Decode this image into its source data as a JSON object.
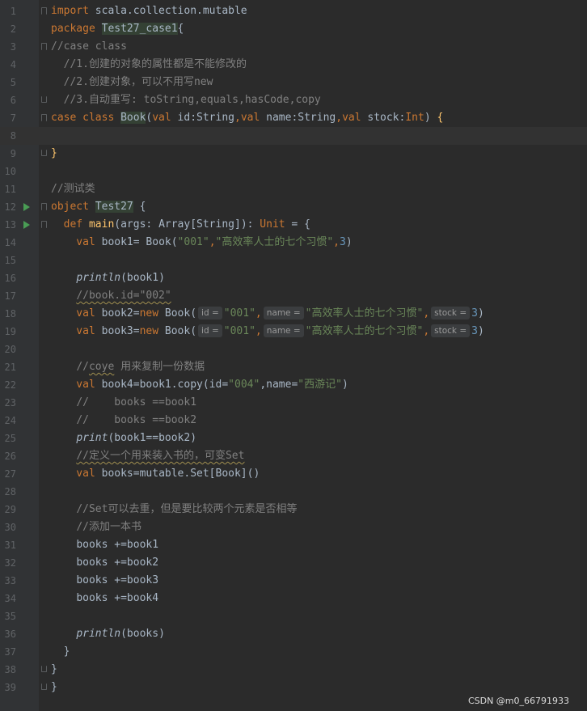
{
  "editor": {
    "lines": [
      {
        "n": "1"
      },
      {
        "n": "2"
      },
      {
        "n": "3"
      },
      {
        "n": "4"
      },
      {
        "n": "5"
      },
      {
        "n": "6"
      },
      {
        "n": "7"
      },
      {
        "n": "8"
      },
      {
        "n": "9"
      },
      {
        "n": "10"
      },
      {
        "n": "11"
      },
      {
        "n": "12"
      },
      {
        "n": "13"
      },
      {
        "n": "14"
      },
      {
        "n": "15"
      },
      {
        "n": "16"
      },
      {
        "n": "17"
      },
      {
        "n": "18"
      },
      {
        "n": "19"
      },
      {
        "n": "20"
      },
      {
        "n": "21"
      },
      {
        "n": "22"
      },
      {
        "n": "23"
      },
      {
        "n": "24"
      },
      {
        "n": "25"
      },
      {
        "n": "26"
      },
      {
        "n": "27"
      },
      {
        "n": "28"
      },
      {
        "n": "29"
      },
      {
        "n": "30"
      },
      {
        "n": "31"
      },
      {
        "n": "32"
      },
      {
        "n": "33"
      },
      {
        "n": "34"
      },
      {
        "n": "35"
      },
      {
        "n": "36"
      },
      {
        "n": "37"
      },
      {
        "n": "38"
      },
      {
        "n": "39"
      }
    ],
    "code": {
      "l1_kw": "import",
      "l1_rest": " scala.collection.mutable",
      "l2_kw": "package",
      "l2_name": "Test27_case1",
      "l2_brace": "{",
      "l3": "//case class",
      "l4": "  //1.创建的对象的属性都是不能修改的",
      "l5": "  //2.创建对象，可以不用写new",
      "l6": "  //3.自动重写: toString,equals,hasCode,copy",
      "l7_kw": "case class ",
      "l7_name": "Book",
      "l7_open": "(",
      "l7_v1": "val ",
      "l7_p1": "id:String",
      "l7_c1": ",",
      "l7_v2": "val ",
      "l7_p2": "name:String",
      "l7_c2": ",",
      "l7_v3": "val ",
      "l7_p3": "stock:",
      "l7_int": "Int",
      "l7_close": ") ",
      "l7_brace": "{",
      "l9": "}",
      "l11": "//测试类",
      "l12_kw": "object ",
      "l12_name": "Test27",
      "l12_rest": " {",
      "l13_kw": "  def ",
      "l13_fn": "main",
      "l13_args": "(args: Array[String]): ",
      "l13_unit": "Unit",
      "l13_rest": " = {",
      "l14_kw": "    val ",
      "l14_a": "book1= Book(",
      "l14_s1": "\"001\"",
      "l14_c": ",",
      "l14_s2": "\"高效率人士的七个习惯\"",
      "l14_c2": ",",
      "l14_n": "3",
      "l14_e": ")",
      "l16_fn": "println",
      "l16_rest": "(book1)",
      "l17": "//book.id=\"002\"",
      "l18_kw": "    val ",
      "l18_a": "book2=",
      "l18_new": "new ",
      "l18_b": "Book(",
      "l18_h1": "id =",
      "l18_s1": "\"001\"",
      "l18_c1": ",",
      "l18_h2": "name =",
      "l18_s2": "\"高效率人士的七个习惯\"",
      "l18_c2": ",",
      "l18_h3": "stock =",
      "l18_n": "3",
      "l18_e": ")",
      "l19_kw": "    val ",
      "l19_a": "book3=",
      "l19_new": "new ",
      "l19_b": "Book(",
      "l19_h1": "id =",
      "l19_s1": "\"001\"",
      "l19_c1": ",",
      "l19_h2": "name =",
      "l19_s2": "\"高效率人士的七个习惯\"",
      "l19_c2": ",",
      "l19_h3": "stock =",
      "l19_n": "3",
      "l19_e": ")",
      "l21a": "//",
      "l21b": "coye",
      "l21c": " 用来复制一份数据",
      "l22_kw": "    val ",
      "l22_a": "book4=book1.copy(id=",
      "l22_s1": "\"004\"",
      "l22_c": ",name=",
      "l22_s2": "\"西游记\"",
      "l22_e": ")",
      "l23": "//    books ==book1",
      "l24": "//    books ==book2",
      "l25_fn": "print",
      "l25_rest": "(book1==book2)",
      "l26": "//定义一个用来装入书的，可变Set",
      "l27_kw": "    val ",
      "l27_rest": "books=mutable.Set[Book]()",
      "l29": "//Set可以去重，但是要比较两个元素是否相等",
      "l30": "//添加一本书",
      "l31": "books +=book1",
      "l32": "books +=book2",
      "l33": "books +=book3",
      "l34": "books +=book4",
      "l36_fn": "println",
      "l36_rest": "(books)",
      "l37": "}",
      "l38": "}",
      "l39": "}"
    }
  },
  "watermark": "CSDN @m0_66791933"
}
